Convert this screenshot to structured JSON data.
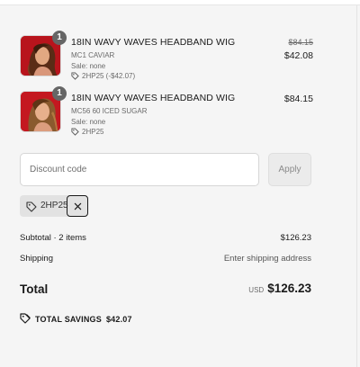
{
  "items": [
    {
      "quantity": "1",
      "title": "18IN WAVY WAVES HEADBAND WIG",
      "variant": "MC1 CAVIAR",
      "sale": "Sale: none",
      "discount_code": "2HP25 (-$42.07)",
      "original_price": "$84.15",
      "price": "$42.08",
      "image_icon": "product-photo-woman-wavy-hair"
    },
    {
      "quantity": "1",
      "title": "18IN WAVY WAVES HEADBAND WIG",
      "variant": "MC56 60 ICED SUGAR",
      "sale": "Sale: none",
      "discount_code": "2HP25",
      "price": "$84.15",
      "image_icon": "product-photo-woman-wavy-hair"
    }
  ],
  "discount": {
    "placeholder": "Discount code",
    "apply_label": "Apply",
    "applied_code": "2HP25"
  },
  "summary": {
    "subtotal_label": "Subtotal · 2 items",
    "subtotal_value": "$126.23",
    "shipping_label": "Shipping",
    "shipping_value": "Enter shipping address",
    "total_label": "Total",
    "currency": "USD",
    "total_value": "$126.23",
    "savings_label": "TOTAL SAVINGS",
    "savings_value": "$42.07"
  },
  "colors": {
    "background": "#f5f5f5",
    "badge": "#666666",
    "chip": "#e2e2e2",
    "product_red": "#b5121b"
  }
}
